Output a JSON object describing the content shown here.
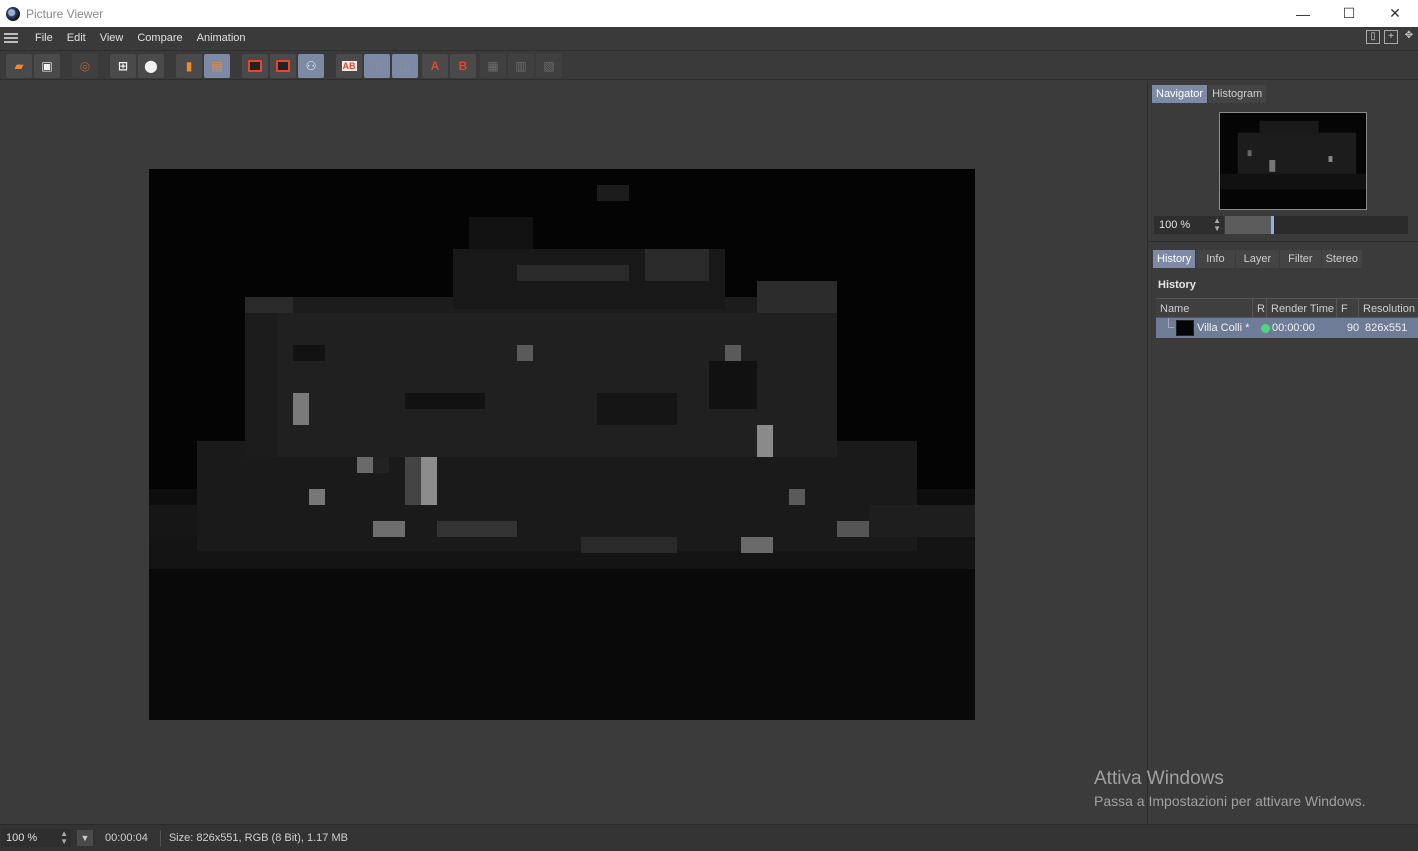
{
  "window": {
    "title": "Picture Viewer",
    "controls": {
      "minimize": "—",
      "maximize": "☐",
      "close": "✕"
    }
  },
  "menu": {
    "items": [
      "File",
      "Edit",
      "View",
      "Compare",
      "Animation"
    ]
  },
  "toolbar": {
    "icons": [
      "open-icon",
      "save-icon",
      "stop-render-icon",
      "crop-icon",
      "export-icon",
      "remove-image-icon",
      "remove-all-icon",
      "single-view-icon",
      "compare-view-icon",
      "channel-view-icon",
      "ab-icon",
      "ab-split-icon",
      "ab-overlay-icon",
      "set-a-icon",
      "set-b-icon",
      "compare-swap-icon",
      "compare-split-icon",
      "compare-diff-icon"
    ],
    "labels": {
      "set_a": "A",
      "set_b": "B",
      "ab": "AB"
    }
  },
  "right_panel": {
    "top_tabs": [
      "Navigator",
      "Histogram"
    ],
    "active_top_tab": "Navigator",
    "zoom_value": "100 %",
    "zoom_slider_fraction": 0.25,
    "bottom_tabs": [
      "History",
      "Info",
      "Layer",
      "Filter",
      "Stereo"
    ],
    "active_bottom_tab": "History",
    "history": {
      "title": "History",
      "columns": [
        "Name",
        "R",
        "Render Time",
        "F",
        "Resolution"
      ],
      "rows": [
        {
          "name": "Villa Colli *",
          "status": "complete",
          "render_time": "00:00:00",
          "frames": "90",
          "resolution": "826x551"
        }
      ]
    }
  },
  "watermark": {
    "line1": "Attiva Windows",
    "line2": "Passa a Impostazioni per attivare Windows."
  },
  "statusbar": {
    "zoom": "100 %",
    "time": "00:00:04",
    "size_info": "Size: 826x551, RGB (8 Bit), 1.17 MB"
  },
  "colors": {
    "accent": "#7d8aa6",
    "status_green": "#4fd67a",
    "orange_icon": "#f08a2e"
  }
}
